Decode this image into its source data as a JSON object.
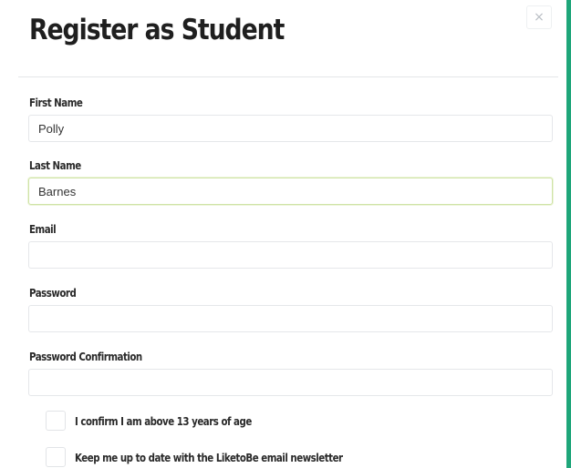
{
  "modal": {
    "title": "Register as Student",
    "close_icon": "close-icon",
    "accent_color": "#1fa67a"
  },
  "form": {
    "first_name": {
      "label": "First Name",
      "value": "Polly"
    },
    "last_name": {
      "label": "Last Name",
      "value": "Barnes"
    },
    "email": {
      "label": "Email",
      "value": ""
    },
    "password": {
      "label": "Password",
      "value": ""
    },
    "password_confirmation": {
      "label": "Password Confirmation",
      "value": ""
    },
    "age_confirm": {
      "label": "I confirm I am above 13 years of age",
      "checked": false
    },
    "newsletter": {
      "label": "Keep me up to date with the LiketoBe email newsletter",
      "checked": false
    }
  }
}
